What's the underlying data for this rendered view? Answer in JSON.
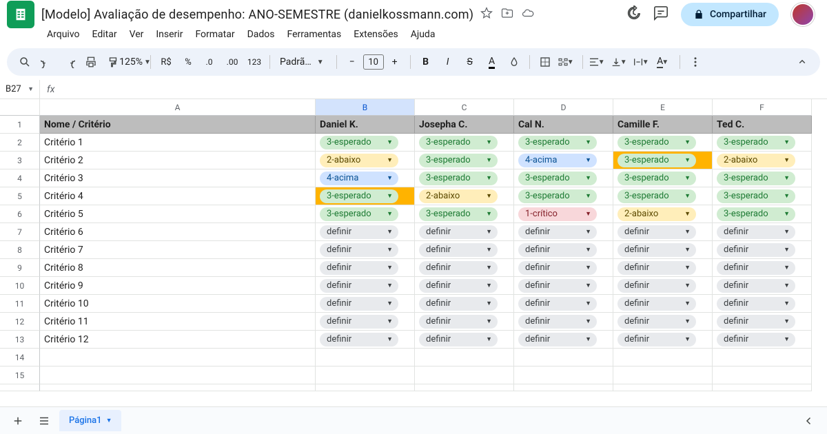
{
  "doc_title": "[Modelo] Avaliação de desempenho: ANO-SEMESTRE (danielkossmann.com)",
  "menus": [
    "Arquivo",
    "Editar",
    "Ver",
    "Inserir",
    "Formatar",
    "Dados",
    "Ferramentas",
    "Extensões",
    "Ajuda"
  ],
  "share_label": "Compartilhar",
  "zoom": "125%",
  "currency_label": "R$",
  "percent_label": "%",
  "format123": "123",
  "font_label": "Padrã…",
  "font_size": "10",
  "namebox": "B27",
  "columns": [
    "A",
    "B",
    "C",
    "D",
    "E",
    "F"
  ],
  "selected_col": "B",
  "header_row": [
    "Nome / Critério",
    "Daniel K.",
    "Josepha C.",
    "Cal N.",
    "Camille F.",
    "Ted C."
  ],
  "rows": [
    {
      "n": 1,
      "label": "Nome / Critério",
      "cells": null
    },
    {
      "n": 2,
      "label": "Critério 1",
      "cells": [
        {
          "v": "3-esperado",
          "c": "green"
        },
        {
          "v": "3-esperado",
          "c": "green"
        },
        {
          "v": "3-esperado",
          "c": "green"
        },
        {
          "v": "3-esperado",
          "c": "green"
        },
        {
          "v": "3-esperado",
          "c": "green"
        }
      ]
    },
    {
      "n": 3,
      "label": "Critério 2",
      "cells": [
        {
          "v": "2-abaixo",
          "c": "yellow"
        },
        {
          "v": "3-esperado",
          "c": "green"
        },
        {
          "v": "4-acima",
          "c": "blue"
        },
        {
          "v": "3-esperado",
          "c": "green",
          "hl": true
        },
        {
          "v": "2-abaixo",
          "c": "yellow"
        }
      ]
    },
    {
      "n": 4,
      "label": "Critério 3",
      "cells": [
        {
          "v": "4-acima",
          "c": "blue"
        },
        {
          "v": "3-esperado",
          "c": "green"
        },
        {
          "v": "3-esperado",
          "c": "green"
        },
        {
          "v": "3-esperado",
          "c": "green"
        },
        {
          "v": "3-esperado",
          "c": "green"
        }
      ]
    },
    {
      "n": 5,
      "label": "Critério 4",
      "cells": [
        {
          "v": "3-esperado",
          "c": "green",
          "hl": true
        },
        {
          "v": "2-abaixo",
          "c": "yellow"
        },
        {
          "v": "3-esperado",
          "c": "green"
        },
        {
          "v": "3-esperado",
          "c": "green"
        },
        {
          "v": "3-esperado",
          "c": "green"
        }
      ]
    },
    {
      "n": 6,
      "label": "Critério 5",
      "cells": [
        {
          "v": "3-esperado",
          "c": "green"
        },
        {
          "v": "3-esperado",
          "c": "green"
        },
        {
          "v": "1-crítico",
          "c": "red"
        },
        {
          "v": "2-abaixo",
          "c": "yellow"
        },
        {
          "v": "3-esperado",
          "c": "green"
        }
      ]
    },
    {
      "n": 7,
      "label": "Critério 6",
      "cells": [
        {
          "v": "definir",
          "c": "grey"
        },
        {
          "v": "definir",
          "c": "grey"
        },
        {
          "v": "definir",
          "c": "grey"
        },
        {
          "v": "definir",
          "c": "grey"
        },
        {
          "v": "definir",
          "c": "grey"
        }
      ]
    },
    {
      "n": 8,
      "label": "Critério 7",
      "cells": [
        {
          "v": "definir",
          "c": "grey"
        },
        {
          "v": "definir",
          "c": "grey"
        },
        {
          "v": "definir",
          "c": "grey"
        },
        {
          "v": "definir",
          "c": "grey"
        },
        {
          "v": "definir",
          "c": "grey"
        }
      ]
    },
    {
      "n": 9,
      "label": "Critério 8",
      "cells": [
        {
          "v": "definir",
          "c": "grey"
        },
        {
          "v": "definir",
          "c": "grey"
        },
        {
          "v": "definir",
          "c": "grey"
        },
        {
          "v": "definir",
          "c": "grey"
        },
        {
          "v": "definir",
          "c": "grey"
        }
      ]
    },
    {
      "n": 10,
      "label": "Critério 9",
      "cells": [
        {
          "v": "definir",
          "c": "grey"
        },
        {
          "v": "definir",
          "c": "grey"
        },
        {
          "v": "definir",
          "c": "grey"
        },
        {
          "v": "definir",
          "c": "grey"
        },
        {
          "v": "definir",
          "c": "grey"
        }
      ]
    },
    {
      "n": 11,
      "label": "Critério 10",
      "cells": [
        {
          "v": "definir",
          "c": "grey"
        },
        {
          "v": "definir",
          "c": "grey"
        },
        {
          "v": "definir",
          "c": "grey"
        },
        {
          "v": "definir",
          "c": "grey"
        },
        {
          "v": "definir",
          "c": "grey"
        }
      ]
    },
    {
      "n": 12,
      "label": "Critério 11",
      "cells": [
        {
          "v": "definir",
          "c": "grey"
        },
        {
          "v": "definir",
          "c": "grey"
        },
        {
          "v": "definir",
          "c": "grey"
        },
        {
          "v": "definir",
          "c": "grey"
        },
        {
          "v": "definir",
          "c": "grey"
        }
      ]
    },
    {
      "n": 13,
      "label": "Critério 12",
      "cells": [
        {
          "v": "definir",
          "c": "grey"
        },
        {
          "v": "definir",
          "c": "grey"
        },
        {
          "v": "definir",
          "c": "grey"
        },
        {
          "v": "definir",
          "c": "grey"
        },
        {
          "v": "definir",
          "c": "grey"
        }
      ]
    },
    {
      "n": 14,
      "label": "",
      "cells": []
    },
    {
      "n": 15,
      "label": "",
      "cells": []
    }
  ],
  "sheet_tab": "Página1"
}
